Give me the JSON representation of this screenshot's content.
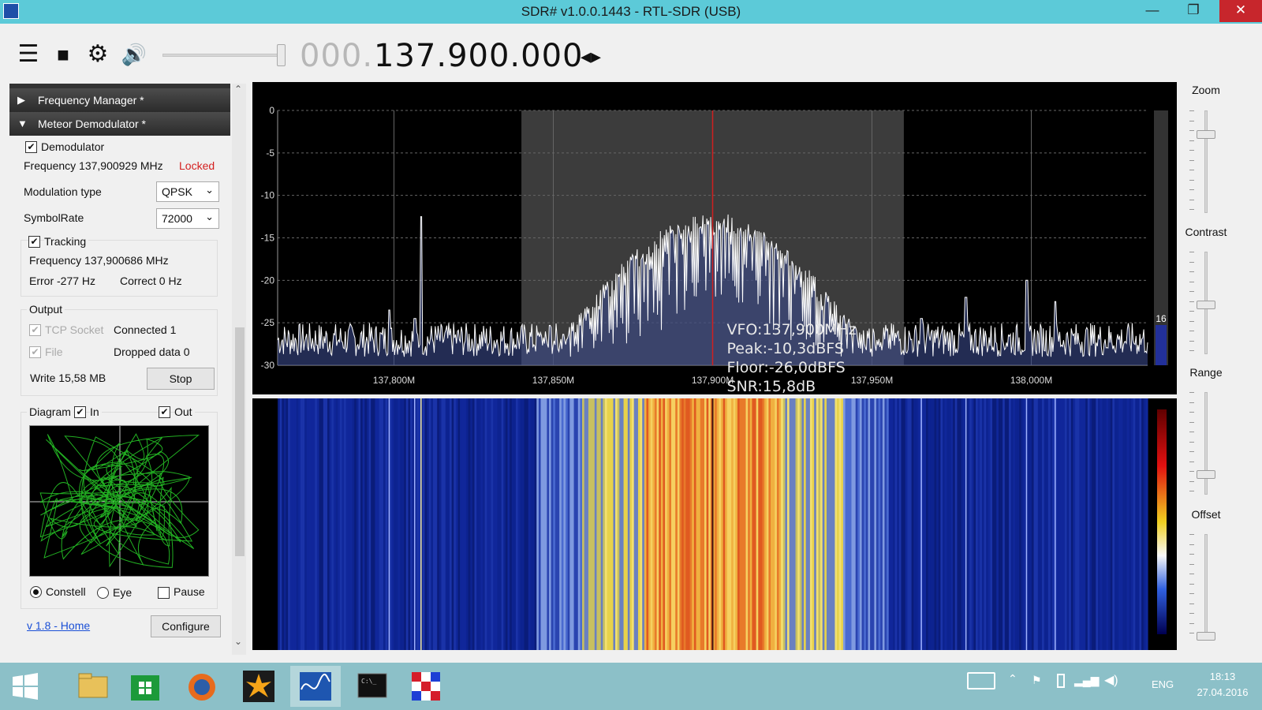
{
  "window": {
    "title": "SDR# v1.0.0.1443 - RTL-SDR (USB)",
    "minimize": "—",
    "restore": "❐",
    "close": "✕"
  },
  "toolbar": {
    "freq_dim": "000.",
    "freq_main": "137.900.000",
    "arrows": "◂▸",
    "menu_icon": "☰",
    "stop_icon": "■",
    "settings_icon": "⚙",
    "speaker_icon": "🔊"
  },
  "sections": {
    "frequency_manager": "Frequency Manager *",
    "meteor_demodulator": "Meteor Demodulator *",
    "collapsed_arrow": "▶",
    "expanded_arrow": "▼"
  },
  "demod": {
    "demodulator_label": "Demodulator",
    "demodulator_checked": true,
    "frequency": "Frequency 137,900929 MHz",
    "status": "Locked",
    "modulation_label": "Modulation type",
    "modulation_value": "QPSK",
    "symbolrate_label": "SymbolRate",
    "symbolrate_value": "72000",
    "tracking_label": "Tracking",
    "tracking_checked": true,
    "tracking_frequency": "Frequency 137,900686 MHz",
    "error": "Error -277 Hz",
    "correct": "Correct 0 Hz"
  },
  "output": {
    "title": "Output",
    "tcp_label": "TCP Socket",
    "tcp_status": "Connected 1",
    "file_label": "File",
    "file_status": "Dropped data 0",
    "write": "Write 15,58 MB",
    "stop_button": "Stop"
  },
  "diagram": {
    "title": "Diagram",
    "in_label": "In",
    "out_label": "Out",
    "constell_label": "Constell",
    "eye_label": "Eye",
    "pause_label": "Pause"
  },
  "footer": {
    "home_link": "v 1.8 - Home",
    "configure_button": "Configure"
  },
  "spectrum": {
    "y_ticks": [
      "0",
      "-5",
      "-10",
      "-15",
      "-20",
      "-25",
      "-30"
    ],
    "x_ticks": [
      "137,800M",
      "137,850M",
      "137,900M",
      "137,950M",
      "138,000M"
    ],
    "vfo": "VFO:137,900MHz",
    "peak": "Peak:-10,3dBFS",
    "floor": "Floor:-26,0dBFS",
    "snr": "SNR:15,8dB",
    "level_label": "16",
    "colors": {
      "trace": "#ffffff",
      "fill": "#3a4a8a",
      "band": "#3c3c3c",
      "vfo_line": "#d02020"
    }
  },
  "chart_data": {
    "type": "line",
    "title": "",
    "xlabel": "",
    "ylabel": "",
    "xlim": [
      137.7635,
      138.0365
    ],
    "ylim": [
      -30,
      0
    ],
    "x_ticks": [
      137.8,
      137.85,
      137.9,
      137.95,
      138.0
    ],
    "filter_band": [
      137.84,
      137.96
    ],
    "vfo": 137.9,
    "noise_floor": -27,
    "signal": {
      "center": 137.9,
      "half_width": 0.048,
      "peak": -12
    },
    "spikes": [
      {
        "x": 137.8085,
        "y": -12.5
      },
      {
        "x": 137.8065,
        "y": -24.5
      },
      {
        "x": 137.7985,
        "y": -23.5
      },
      {
        "x": 137.9655,
        "y": -24.5
      },
      {
        "x": 137.9795,
        "y": -22
      },
      {
        "x": 137.9985,
        "y": -20
      },
      {
        "x": 138.0075,
        "y": -22.5
      }
    ]
  },
  "sliders": {
    "zoom": "Zoom",
    "contrast": "Contrast",
    "range": "Range",
    "offset": "Offset",
    "zoom_level": 0.8,
    "contrast_level": 0.5,
    "range_level": 0.2,
    "offset_level": 0.0
  },
  "taskbar": {
    "lang": "ENG",
    "time": "18:13",
    "date": "27.04.2016"
  }
}
